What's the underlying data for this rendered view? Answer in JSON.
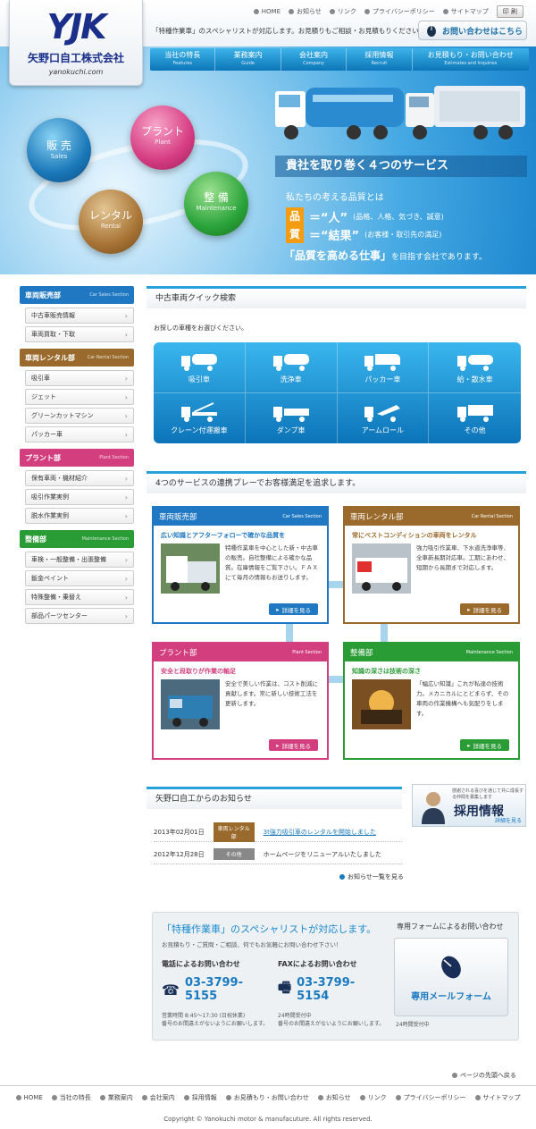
{
  "header": {
    "brand_mark": "YJK",
    "company_name": "矢野口自工株式会社",
    "url": "yanokuchi.com",
    "tagline": "「特種作業車」のスペシャリストが対応します。お見積りもご相談・お見積もりください！",
    "contact_button": "お問い合わせはこちら",
    "top_links": [
      "HOME",
      "お知らせ",
      "リンク",
      "プライバシーポリシー",
      "サイトマップ"
    ],
    "print_label": "印 刷"
  },
  "nav": [
    {
      "ja": "当社の特長",
      "en": "Features"
    },
    {
      "ja": "業務案内",
      "en": "Guide"
    },
    {
      "ja": "会社案内",
      "en": "Company"
    },
    {
      "ja": "採用情報",
      "en": "Recruit"
    },
    {
      "ja": "お見積もり・お問い合わせ",
      "en": "Estimates and Inquiries"
    }
  ],
  "hero": {
    "balls": [
      {
        "ja": "販 売",
        "en": "Sales"
      },
      {
        "ja": "プラント",
        "en": "Plant"
      },
      {
        "ja": "レンタル",
        "en": "Rental"
      },
      {
        "ja": "整 備",
        "en": "Maintenance"
      }
    ],
    "title": "貴社を取り巻く４つのサービス",
    "subtitle": "私たちの考える品質とは",
    "line1_kanji": "品",
    "line1_quote": "＝“人”",
    "line1_note": "(品格、人格、気づき、誠意)",
    "line2_kanji": "質",
    "line2_quote": "＝“結果”",
    "line2_note": "(お客様・取引先の満足)",
    "bottom_em": "「品質を高める仕事」",
    "bottom_rest": "を目指す会社であります。"
  },
  "sidebar": [
    {
      "title": "車両販売部",
      "en": "Car Sales Section",
      "color": "#1f78c1",
      "items": [
        "中古車販売情報",
        "車両買取・下取"
      ]
    },
    {
      "title": "車両レンタル部",
      "en": "Car Rental Section",
      "color": "#9a6a2c",
      "items": [
        "吸引車",
        "ジェット",
        "グリーンカットマシン",
        "パッカー車"
      ]
    },
    {
      "title": "プラント部",
      "en": "Plant Section",
      "color": "#d23e7e",
      "items": [
        "保有車両・機材紹介",
        "吸引作業実例",
        "脱水作業実例"
      ]
    },
    {
      "title": "整備部",
      "en": "Maintenance Section",
      "color": "#2a9c36",
      "items": [
        "車検・一般整備・出張整備",
        "鈑金ペイント",
        "特殊整備・乗替え",
        "部品パーツセンター"
      ]
    }
  ],
  "search": {
    "heading": "中古車両クイック検索",
    "intro": "お探しの車種をお選びください。",
    "vehicles": [
      "吸引車",
      "洗浄車",
      "パッカー車",
      "給・散水車",
      "クレーン付運搬車",
      "ダンプ車",
      "アームロール",
      "その他"
    ]
  },
  "services": {
    "heading": "4つのサービスの連携プレーでお客様満足を追求します。",
    "panels": [
      {
        "title": "車両販売部",
        "en": "Car Sales Section",
        "color": "#1f78c1",
        "lead": "広い知識とアフターフォローで確かな品質を",
        "text": "特種作業車を中心とした新・中古車の販売。自社整備による確かな品質。在庫情報をご覧下さい。ＦＡＸにて毎月の情報もお送りします。",
        "btn": "詳細を見る"
      },
      {
        "title": "車両レンタル部",
        "en": "Car Rental Section",
        "color": "#9a6a2c",
        "lead": "常にベストコンディションの車両をレンタル",
        "text": "強力吸引作業車、下水道洗浄車等、全車新長期対応車。工期にあわせ、短期から長期まで対応します。",
        "btn": "詳細を見る"
      },
      {
        "title": "プラント部",
        "en": "Plant Section",
        "color": "#d23e7e",
        "lead": "安全と段取りが作業の軸足",
        "text": "安全で美しい作業は、コスト削減に貢献します。常に新しい技術工法を更新します。",
        "btn": "詳細を見る"
      },
      {
        "title": "整備部",
        "en": "Maintenance Section",
        "color": "#2a9c36",
        "lead": "知識の深さは技術の深さ",
        "text": "「幅広い知識」これが私達の技術力。メカニカルにとどまらず、その車両の作業機構へも気配りをします。",
        "btn": "詳細を見る"
      }
    ]
  },
  "news": {
    "heading": "矢野口自工からのお知らせ",
    "items": [
      {
        "date": "2013年02月01日",
        "tag": "車両レンタル部",
        "tag_color": "#9a6a2c",
        "text": "3t強力吸引車のレンタルを開始しました"
      },
      {
        "date": "2012年12月28日",
        "tag": "その他",
        "tag_color": "#888888",
        "text": "ホームページをリニューアルいたしました"
      }
    ],
    "more": "お知らせ一覧を見る"
  },
  "recruit": {
    "small": "感謝される喜びを通じて共に成長する仲間を募集します",
    "title": "採用情報",
    "link": "詳細を見る"
  },
  "contact": {
    "title": "「特種作業車」のスペシャリストが対応します。",
    "sub": "お見積もり・ご質問・ご相談、何でもお気軽にお問い合わせ下さい！",
    "tel_label": "電話によるお問い合わせ",
    "tel": "03-3799-5155",
    "tel_note1": "営業時間 8:45～17:30 (日祝休業)",
    "tel_note2": "番号のお間違えがないようにお願いします。",
    "fax_label": "FAXによるお問い合わせ",
    "fax": "03-3799-5154",
    "fax_note1": "24時間受付中",
    "fax_note2": "番号のお間違えがないようにお願いします。",
    "form_label": "専用フォームによるお問い合わせ",
    "form_button": "専用メールフォーム",
    "form_note": "24時間受付中"
  },
  "footer": {
    "pagetop": "ページの先頭へ戻る",
    "links": [
      "HOME",
      "当社の特長",
      "業務案内",
      "会社案内",
      "採用情報",
      "お見積もり・お問い合わせ",
      "お知らせ",
      "リンク",
      "プライバシーポリシー",
      "サイトマップ"
    ],
    "copyright": "Copyright © Yanokuchi motor & manufacuture. All rights reserved."
  }
}
